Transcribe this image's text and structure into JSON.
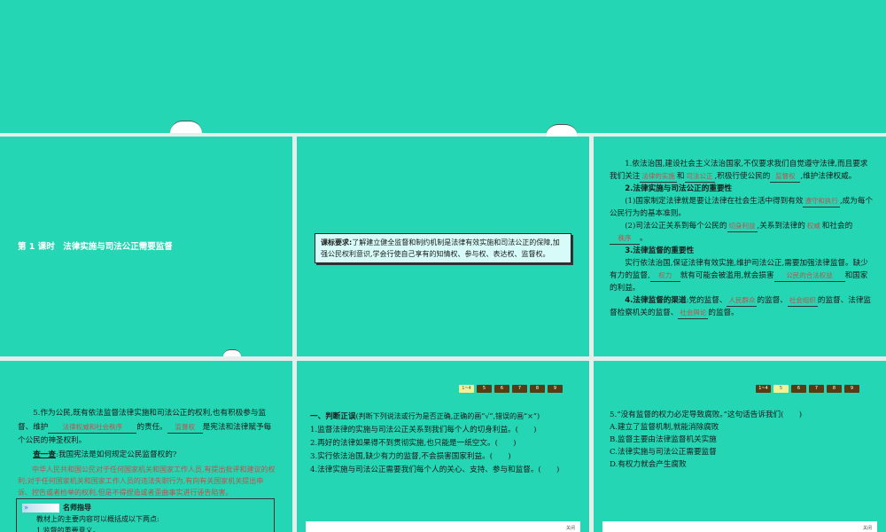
{
  "slide1": {
    "title": "第 1 课时　法律实施与司法公正需要监督"
  },
  "slide2": {
    "req_label": "课标要求:",
    "req_text": "了解建立健全监督和制约机制是法律有效实施和司法公正的保障,加强公民权利意识,学会行使自己享有的知情权、参与权、表达权、监督权。"
  },
  "slide3": {
    "p1a": "1.依法治国,建设社会主义法治国家,不仅要求我们自觉遵守法律,而且要求我们关注",
    "f1": "法律的实施",
    "p1b": "和",
    "f2": "司法公正",
    "p1c": ",积极行使公民的",
    "f3": "监督权",
    "p1d": ",维护法律权威。",
    "h2": "2.法律实施与司法公正的重要性",
    "p2a": "(1)国家制定法律就是要让法律在社会生活中得到有效",
    "f4": "遵守和执行",
    "p2b": ",成为每个公民行为的基本准则。",
    "p3a": "(2)司法公正关系到每个公民的",
    "f5": "切身利益",
    "p3b": ",关系到法律的",
    "f6": "权威",
    "p3c": "和社会的",
    "f7": "秩序",
    "p3d": "。",
    "h3": "3.法律监督的重要性",
    "p4a": "实行依法治国,保证法律有效实施,维护司法公正,需要加强法律监督。缺少有力的监督,",
    "f8": "权力",
    "p4b": "就有可能会被滥用,就会损害",
    "f9": "公民的合法权益",
    "p4c": "和国家的利益。",
    "h4": "4.法律监督的渠道",
    "p5a": ":党的监督、",
    "f10": "人民群众",
    "p5b": "的监督、",
    "f11": "社会组织",
    "p5c": "的监督、法律监督检察机关的监督、",
    "f12": "社会舆论",
    "p5d": "的监督。"
  },
  "slide4": {
    "p1a": "5.作为公民,既有依法监督法律实施和司法公正的权利,也有积极参与监督、维护",
    "f1": "法律权威和社会秩序",
    "p1b": "的责任。",
    "f2": "监督权",
    "p1c": "是宪法和法律赋予每个公民的神圣权利。",
    "check_label": "查一查",
    "check_q": ":我国宪法是如何规定公民监督权的?",
    "answer": "中华人民共和国公民对于任何国家机关和国家工作人员,有提出批评和建议的权利;对于任何国家机关和国家工作人员的违法失职行为,有向有关国家机关提出申诉、控告或者检举的权利,但是不得捏造或者歪曲事实进行诬告陷害。",
    "tip_title": "名师指导",
    "tip_line1": "教材上的主要内容可以概括成以下两点:",
    "tip_line2": "1.监督的重要意义。"
  },
  "pager": [
    "1~4",
    "5",
    "6",
    "7",
    "8",
    "9"
  ],
  "slide5": {
    "heading": "一、判断正误",
    "instr": "(判断下列说法或行为是否正确,正确的画“√”,错误的画“×”)",
    "items": [
      "1.监督法律的实施与司法公正关系到我们每个人的切身利益。(　　)",
      "2.再好的法律如果得不到贯彻实施,也只能是一纸空文。(　　)",
      "3.实行依法治国,缺少有力的监督,不会损害国家利益。(　　)",
      "4.法律实施与司法公正需要我们每个人的关心、支持、参与和监督。(　　)"
    ],
    "close": "关闭"
  },
  "slide6": {
    "question": "5.“没有监督的权力必定导致腐败。”这句话告诉我们(　　)",
    "options": [
      "A.建立了监督机制,就能消除腐败",
      "B.监督主要由法律监督机关实施",
      "C.法律实施与司法公正需要监督",
      "D.有权力就会产生腐败"
    ],
    "close": "关闭"
  }
}
